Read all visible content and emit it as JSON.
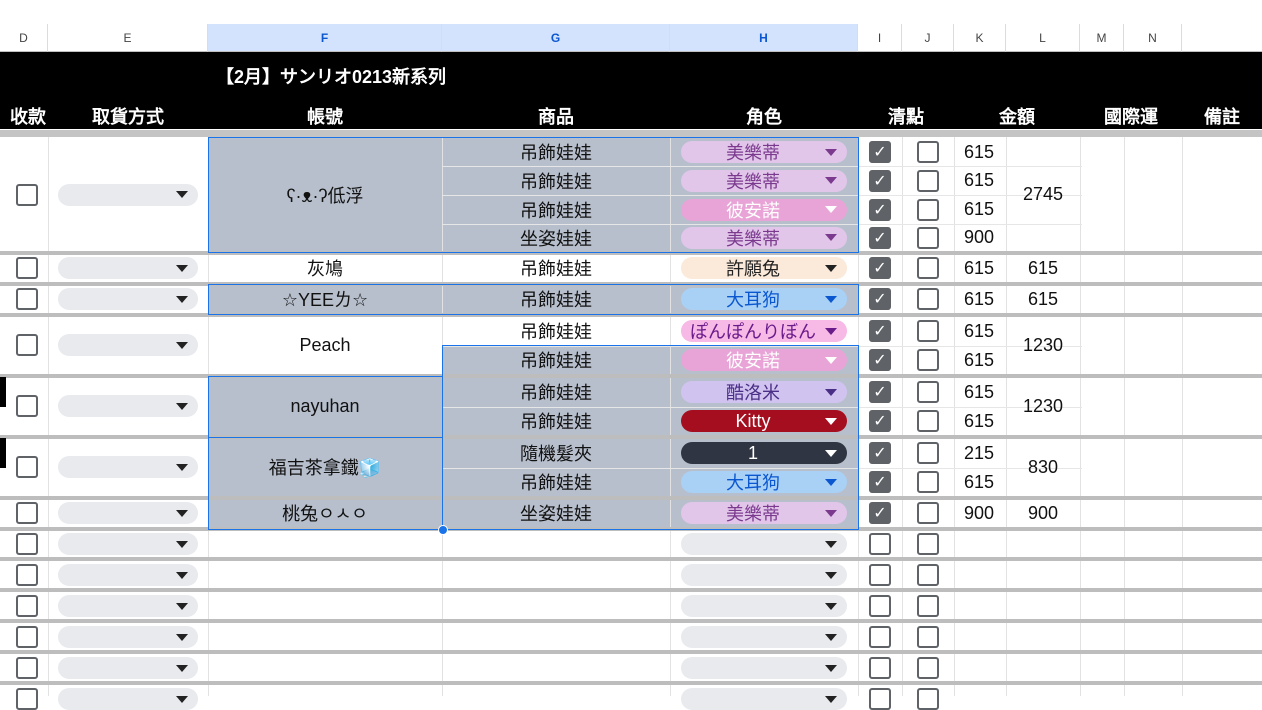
{
  "columns": [
    "D",
    "E",
    "F",
    "G",
    "H",
    "I",
    "J",
    "K",
    "L",
    "M",
    "N"
  ],
  "sheet_title": "【2月】サンリオ0213新系列",
  "headers": {
    "payment": "收款",
    "pickup": "取貨方式",
    "account": "帳號",
    "product": "商品",
    "character": "角色",
    "check": "清點",
    "amount": "金額",
    "intl_shipping": "國際運",
    "notes": "備註"
  },
  "accounts": [
    "ʕ·ᴥ·ʔ低浮",
    "灰鳩",
    "☆YEEㄌ☆",
    "Peach",
    "nayuhan",
    "福吉茶拿鐵🧊",
    "桃兔ㅇㅅㅇ"
  ],
  "rows": [
    {
      "product": "吊飾娃娃",
      "character": "美樂蒂",
      "price": "615"
    },
    {
      "product": "吊飾娃娃",
      "character": "美樂蒂",
      "price": "615"
    },
    {
      "product": "吊飾娃娃",
      "character": "彼安諾",
      "price": "615"
    },
    {
      "product": "坐姿娃娃",
      "character": "美樂蒂",
      "price": "900"
    },
    {
      "product": "吊飾娃娃",
      "character": "許願兔",
      "price": "615"
    },
    {
      "product": "吊飾娃娃",
      "character": "大耳狗",
      "price": "615"
    },
    {
      "product": "吊飾娃娃",
      "character": "ぽんぽんりぼん",
      "price": "615"
    },
    {
      "product": "吊飾娃娃",
      "character": "彼安諾",
      "price": "615"
    },
    {
      "product": "吊飾娃娃",
      "character": "酷洛米",
      "price": "615"
    },
    {
      "product": "吊飾娃娃",
      "character": "Kitty",
      "price": "615"
    },
    {
      "product": "隨機髮夾",
      "character": "1",
      "price": "215"
    },
    {
      "product": "吊飾娃娃",
      "character": "大耳狗",
      "price": "615"
    },
    {
      "product": "坐姿娃娃",
      "character": "美樂蒂",
      "price": "900"
    }
  ],
  "totals": [
    "2745",
    "615",
    "615",
    "1230",
    "1230",
    "830",
    "900"
  ],
  "colors": {
    "header_bg": "#000000",
    "selected_header": "#d3e3fd",
    "shaded_cell": "#b7bfcc",
    "melody_chip": "#e1c6ea",
    "piano_chip": "#e8a4d6",
    "wish_chip": "#fbe9d9",
    "cinnamoroll_chip": "#a9d0f5",
    "ponpon_chip": "#f7b9e6",
    "kuromi_chip": "#d1c3f0",
    "kitty_chip": "#a50e1e",
    "clip_chip": "#2f3542"
  }
}
